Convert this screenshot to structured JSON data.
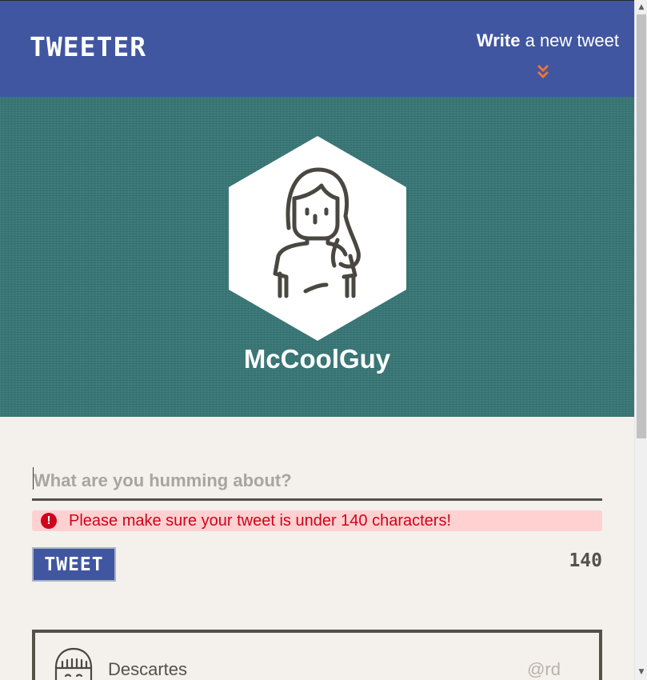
{
  "nav": {
    "brand": "TWEETER",
    "compose_bold": "Write",
    "compose_rest": " a new tweet",
    "chevron_icon": "double-chevron-down-icon",
    "background": "#4056a1",
    "accent": "#e8743b"
  },
  "profile": {
    "username": "McCoolGuy",
    "avatar_icon": "person-avatar-icon",
    "header_background": "#3a7777"
  },
  "compose": {
    "placeholder": "What are you humming about?",
    "value": "",
    "error_icon": "!",
    "error_message": "Please make sure your tweet is under 140 characters!",
    "button_label": "TWEET",
    "counter": "140"
  },
  "tweets": [
    {
      "name": "Descartes",
      "handle": "@rd",
      "avatar_icon": "person-avatar-icon"
    }
  ],
  "scrollbar": {
    "up_icon": "▲",
    "down_icon": "▼"
  }
}
